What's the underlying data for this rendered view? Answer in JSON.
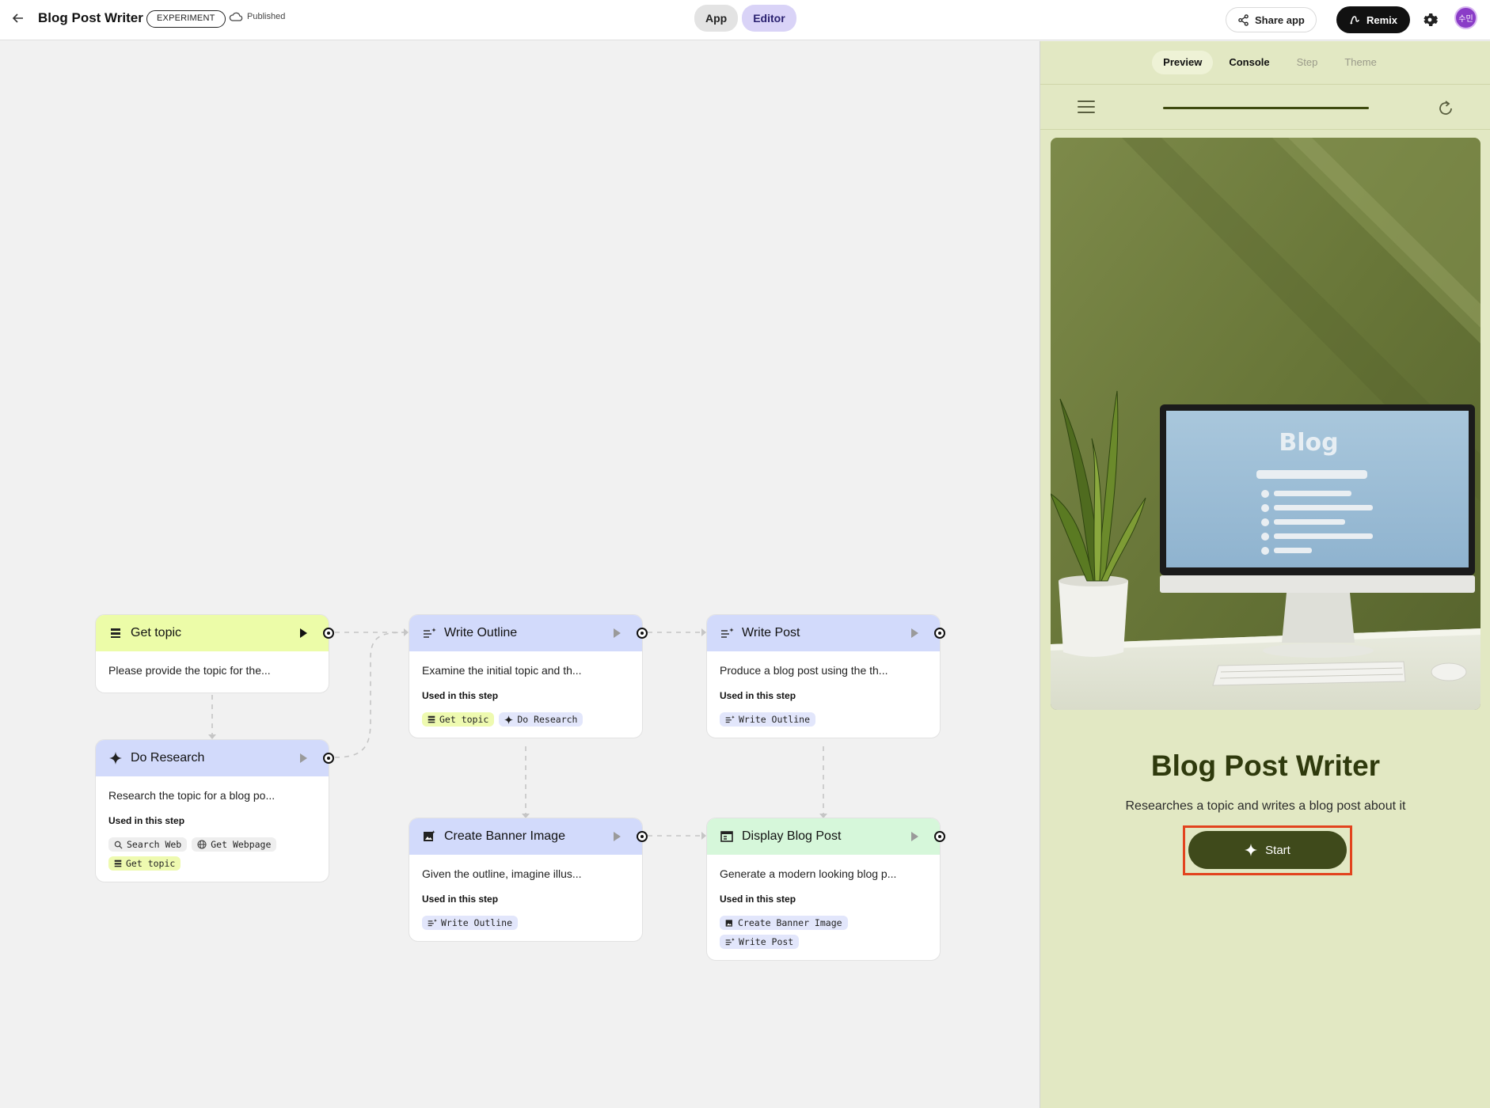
{
  "topbar": {
    "title": "Blog Post Writer",
    "badge": "EXPERIMENT",
    "status": "Published",
    "mode_app": "App",
    "mode_editor": "Editor",
    "share_label": "Share app",
    "remix_label": "Remix",
    "avatar_text": "수민"
  },
  "nodes": [
    {
      "title": "Get topic",
      "desc": "Please provide the topic for the..."
    },
    {
      "title": "Do Research",
      "desc": "Research the topic for a blog po...",
      "used_label": "Used in this step",
      "chips": [
        "Search Web",
        "Get Webpage",
        "Get topic"
      ]
    },
    {
      "title": "Write Outline",
      "desc": "Examine the initial topic and th...",
      "used_label": "Used in this step",
      "chips": [
        "Get topic",
        "Do Research"
      ]
    },
    {
      "title": "Write Post",
      "desc": "Produce a blog post using the th...",
      "used_label": "Used in this step",
      "chips": [
        "Write Outline"
      ]
    },
    {
      "title": "Create Banner Image",
      "desc": "Given the outline, imagine illus...",
      "used_label": "Used in this step",
      "chips": [
        "Write Outline"
      ]
    },
    {
      "title": "Display Blog Post",
      "desc": "Generate a modern looking blog p...",
      "used_label": "Used in this step",
      "chips": [
        "Create Banner Image",
        "Write Post"
      ]
    }
  ],
  "panel": {
    "tabs": [
      "Preview",
      "Console",
      "Step",
      "Theme"
    ],
    "progress": 1.0,
    "screen_word": "Blog",
    "app_title": "Blog Post Writer",
    "app_subtitle": "Researches a topic and writes a blog post about it",
    "start_label": "Start"
  },
  "colors": {
    "input_header": "#ecfca8",
    "generate_header": "#d2dafb",
    "output_header": "#d6f7da",
    "panel_bg": "#e2e8c3",
    "start_button": "#3f4a1b",
    "highlight": "#e2431e",
    "editor_active": "#d9d3f7"
  }
}
